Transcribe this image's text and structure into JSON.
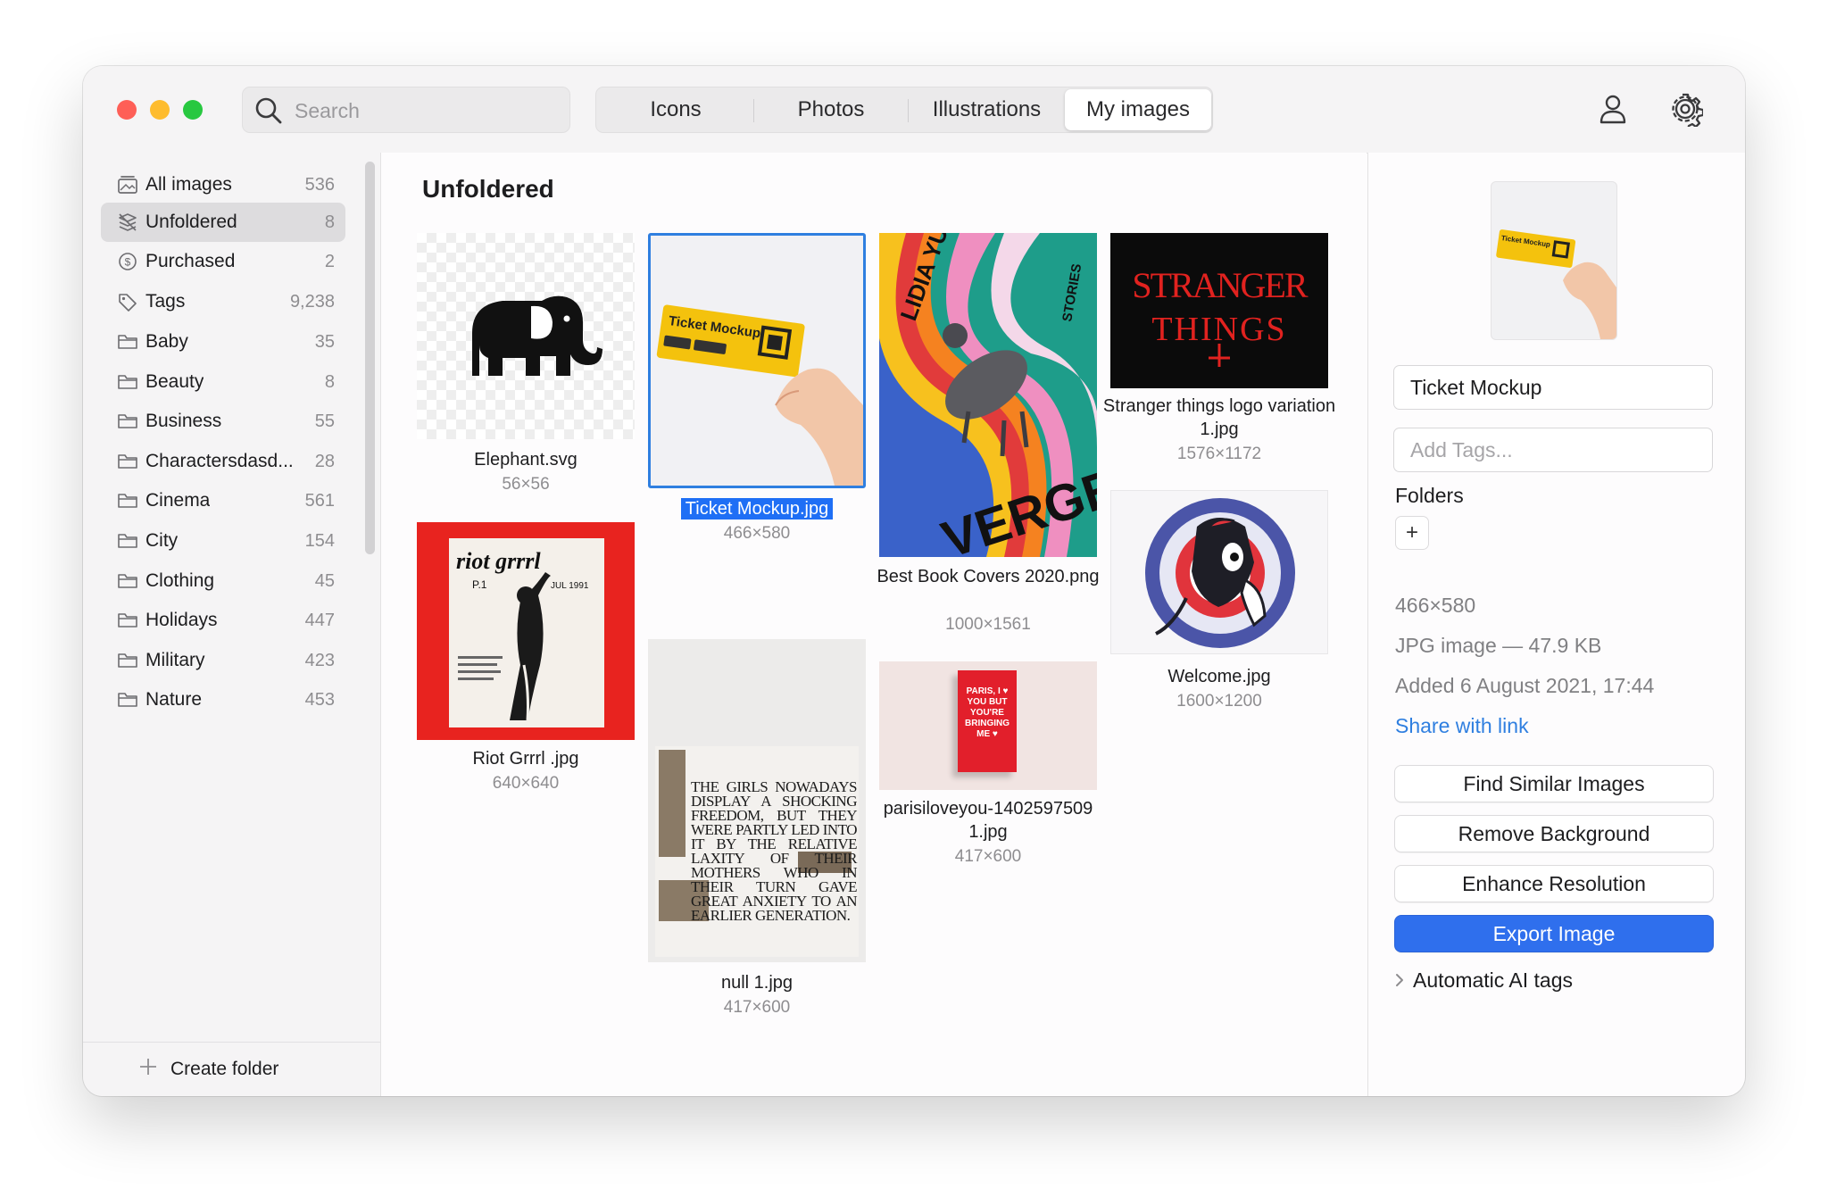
{
  "toolbar": {
    "search_placeholder": "Search",
    "tabs": [
      {
        "label": "Icons"
      },
      {
        "label": "Photos"
      },
      {
        "label": "Illustrations"
      },
      {
        "label": "My images",
        "active": true
      }
    ]
  },
  "sidebar": {
    "items": [
      {
        "label": "All images",
        "count": "536",
        "icon": "images-stack-icon"
      },
      {
        "label": "Unfoldered",
        "count": "8",
        "icon": "unfoldered-icon",
        "selected": true
      },
      {
        "label": "Purchased",
        "count": "2",
        "icon": "dollar-circle-icon"
      },
      {
        "label": "Tags",
        "count": "9,238",
        "icon": "tag-icon"
      },
      {
        "label": "Baby",
        "count": "35",
        "icon": "folder-icon"
      },
      {
        "label": "Beauty",
        "count": "8",
        "icon": "folder-icon"
      },
      {
        "label": "Business",
        "count": "55",
        "icon": "folder-icon"
      },
      {
        "label": "Charactersdasd...",
        "count": "28",
        "icon": "folder-icon"
      },
      {
        "label": "Cinema",
        "count": "561",
        "icon": "folder-icon"
      },
      {
        "label": "City",
        "count": "154",
        "icon": "folder-icon"
      },
      {
        "label": "Clothing",
        "count": "45",
        "icon": "folder-icon"
      },
      {
        "label": "Holidays",
        "count": "447",
        "icon": "folder-icon"
      },
      {
        "label": "Military",
        "count": "423",
        "icon": "folder-icon"
      },
      {
        "label": "Nature",
        "count": "453",
        "icon": "folder-icon"
      }
    ],
    "create_folder": "Create folder"
  },
  "main": {
    "title": "Unfoldered",
    "images": [
      {
        "name": "Elephant.svg",
        "dims": "56×56"
      },
      {
        "name": "Ticket Mockup.jpg",
        "dims": "466×580",
        "selected": true
      },
      {
        "name": "Best Book Covers 2020.png",
        "dims": "1000×1561"
      },
      {
        "name": "Stranger things logo variation 1.jpg",
        "dims": "1576×1172"
      },
      {
        "name": "Riot Grrrl .jpg",
        "dims": "640×640"
      },
      {
        "name": "null 1.jpg",
        "dims": "417×600"
      },
      {
        "name": "parisiloveyou-1402597509 1.jpg",
        "dims": "417×600"
      },
      {
        "name": "Welcome.jpg",
        "dims": "1600×1200"
      }
    ],
    "thumb_text": {
      "ticket": "Ticket Mockup",
      "book_author": "LIDIA YUKNAVITCH",
      "book_side": "STORIES",
      "book_title": "VERGE",
      "stranger_line1": "STRANGER",
      "stranger_line2": "THINGS",
      "riot_title": "riot grrrl",
      "riot_issue": "P.1",
      "riot_date": "JUL 1991",
      "null_text": "THE GIRLS NOWADAYS DISPLAY A SHOCKING FREEDOM, BUT THEY WERE PARTLY LED INTO IT BY THE RELATIVE LAXITY OF THEIR MOTHERS WHO IN THEIR TURN GAVE GREAT ANXIETY TO AN EARLIER GENERATION.",
      "paris_text": "PARIS, I ♥ YOU BUT YOU'RE BRINGING ME ♥"
    }
  },
  "details": {
    "title_value": "Ticket Mockup",
    "tags_placeholder": "Add Tags...",
    "folders_label": "Folders",
    "add_folder": "+",
    "dimensions": "466×580",
    "file_info": "JPG image — 47.9 KB",
    "added": "Added 6 August 2021, 17:44",
    "share_link": "Share with link",
    "find_similar": "Find Similar Images",
    "remove_bg": "Remove Background",
    "enhance": "Enhance Resolution",
    "export": "Export Image",
    "ai_tags": "Automatic AI tags"
  },
  "colors": {
    "accent": "#2f6fed",
    "selection": "#1f6ff5",
    "link": "#2f7fe0",
    "close": "#fe5f57",
    "minimize": "#febc2e",
    "zoom": "#28c840"
  }
}
